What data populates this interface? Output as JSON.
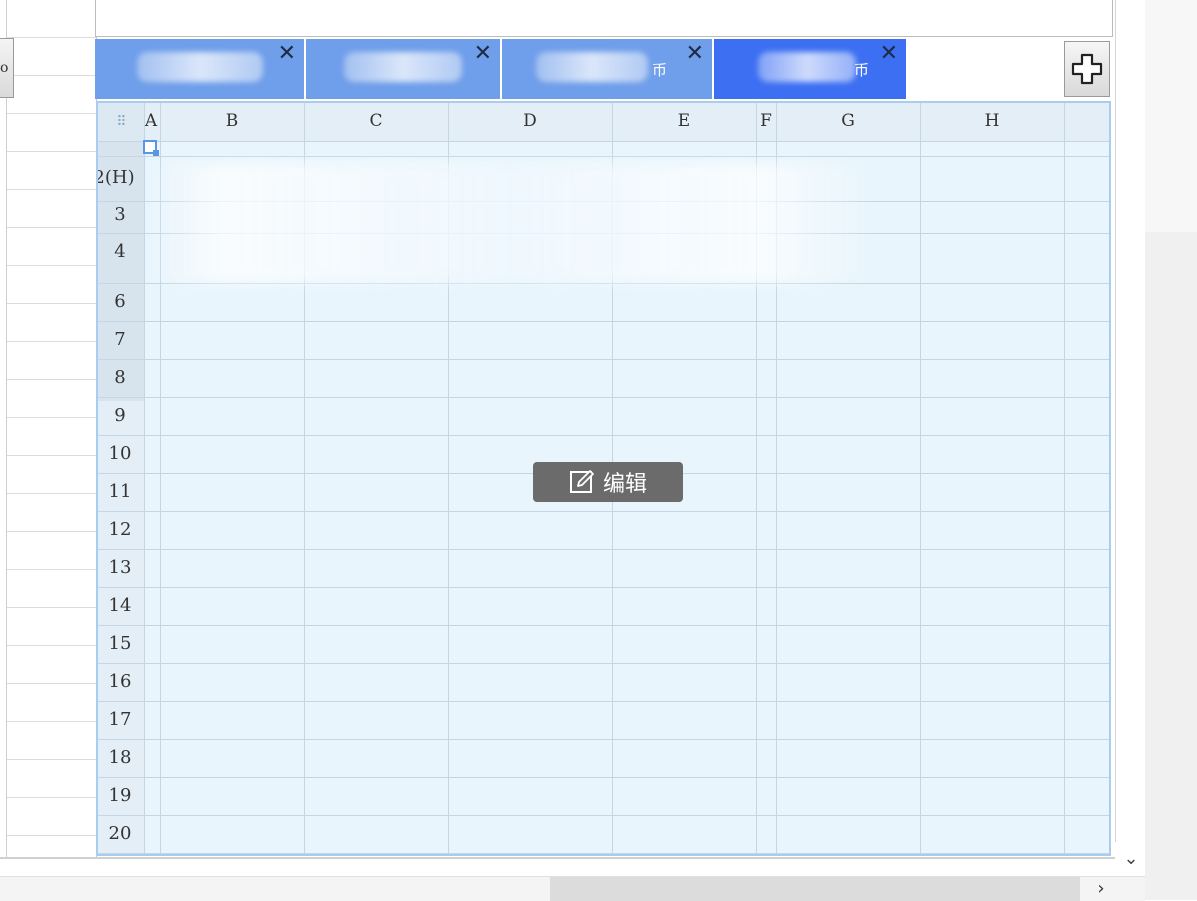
{
  "sheet_tabs": [
    {
      "suffix": "",
      "active": false
    },
    {
      "suffix": "",
      "active": false
    },
    {
      "suffix": "币",
      "active": false
    },
    {
      "suffix": "币",
      "active": true
    }
  ],
  "tab_close_glyph": "✕",
  "left_button_glyph": "o",
  "columns": [
    "A",
    "B",
    "C",
    "D",
    "E",
    "F",
    "G",
    "H"
  ],
  "rows": [
    "2(H)",
    "3",
    "4",
    "6",
    "7",
    "8",
    "9",
    "10",
    "11",
    "12",
    "13",
    "14",
    "15",
    "16",
    "17",
    "18",
    "19",
    "20"
  ],
  "corner_glyph": "⠿",
  "edit_button": {
    "label": "编辑",
    "icon": "edit-icon"
  },
  "scroll": {
    "down_glyph": "⌄",
    "right_glyph": "›"
  },
  "colors": {
    "tab_inactive": "#6f9eea",
    "tab_active": "#3c6ff2",
    "grid_background": "#e8f5fc",
    "selection_border": "#a9cdf0",
    "edit_button_bg": "#6b6b6b"
  }
}
